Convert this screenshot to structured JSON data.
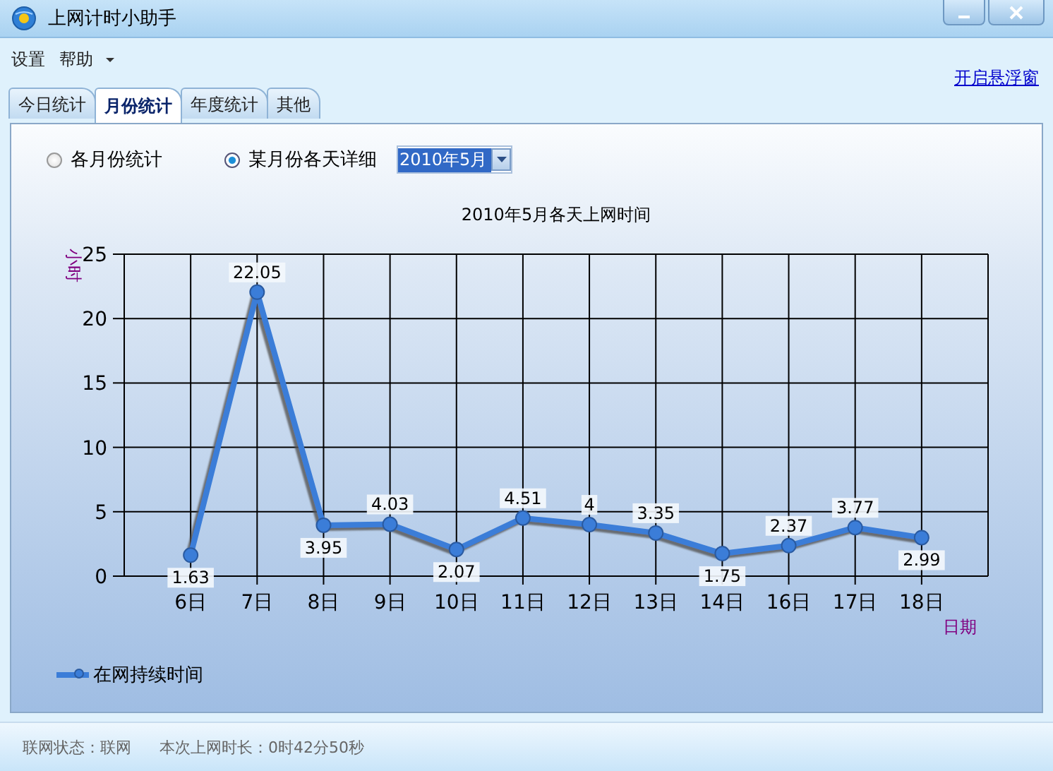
{
  "window": {
    "title": "上网计时小助手"
  },
  "menu": [
    {
      "label": "设置",
      "has_dropdown": false
    },
    {
      "label": "帮助",
      "has_dropdown": true
    }
  ],
  "float_link": "开启悬浮窗",
  "tabs": [
    {
      "label": "今日统计",
      "selected": false
    },
    {
      "label": "月份统计",
      "selected": true
    },
    {
      "label": "年度统计",
      "selected": false
    },
    {
      "label": "其他",
      "selected": false
    }
  ],
  "view_options": [
    {
      "label": "各月份统计",
      "selected": false
    },
    {
      "label": "某月份各天详细",
      "selected": true
    }
  ],
  "month_select": {
    "value": "2010年5月"
  },
  "chart_data": {
    "type": "line",
    "title": "2010年5月各天上网时间",
    "xlabel": "日期",
    "ylabel": "小时",
    "categories": [
      "6日",
      "7日",
      "8日",
      "9日",
      "10日",
      "11日",
      "12日",
      "13日",
      "14日",
      "16日",
      "17日",
      "18日"
    ],
    "series": [
      {
        "name": "在网持续时间",
        "color": "#3b7dd8",
        "marker": "circle",
        "values": [
          1.63,
          22.05,
          3.95,
          4.03,
          2.07,
          4.51,
          4,
          3.35,
          1.75,
          2.37,
          3.77,
          2.99
        ]
      }
    ],
    "ylim": [
      0,
      25
    ],
    "yticks": [
      0,
      5,
      10,
      15,
      20,
      25
    ],
    "grid": true,
    "data_labels": true
  },
  "status_bar": [
    {
      "label": "联网状态：",
      "value": "联网"
    },
    {
      "label": "本次上网时长：",
      "value": "0时42分50秒"
    }
  ]
}
